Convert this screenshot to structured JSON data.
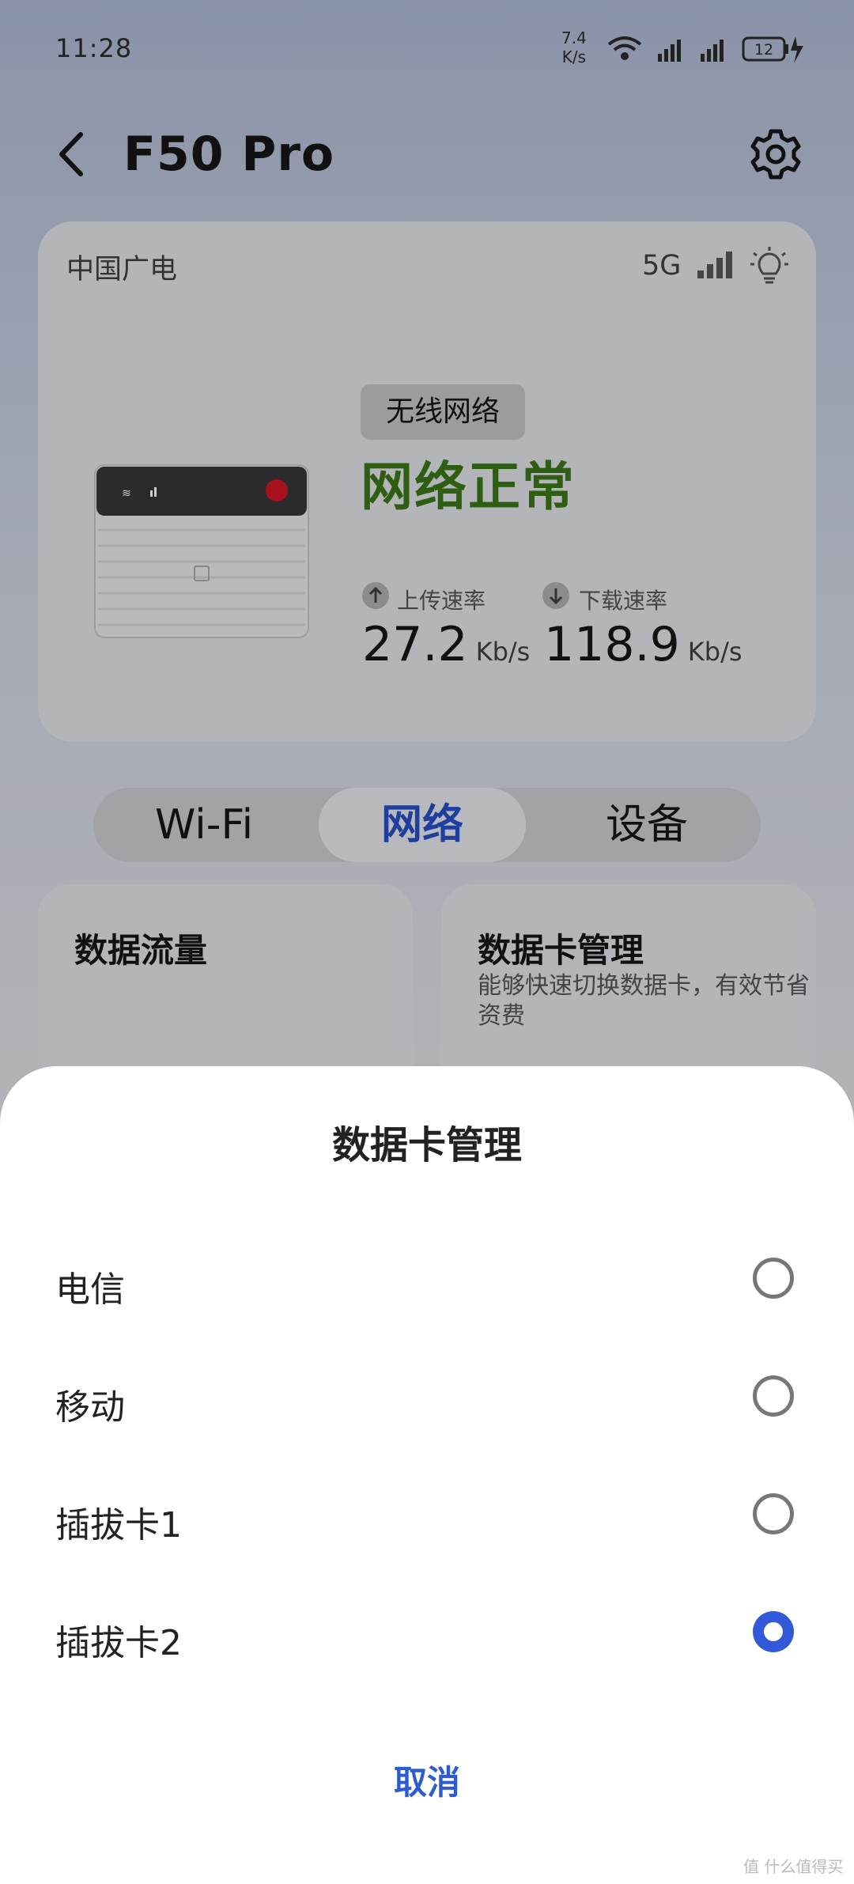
{
  "status_bar": {
    "time": "11:28",
    "net_speed_value": "7.4",
    "net_speed_unit": "K/s",
    "battery": "12"
  },
  "header": {
    "title": "F50 Pro"
  },
  "device_card": {
    "carrier": "中国广电",
    "network_type": "5G",
    "connection_badge": "无线网络",
    "network_status": "网络正常",
    "upload_label": "上传速率",
    "upload_value": "27.2",
    "upload_unit": "Kb/s",
    "download_label": "下载速率",
    "download_value": "118.9",
    "download_unit": "Kb/s"
  },
  "tabs": [
    {
      "label": "Wi-Fi"
    },
    {
      "label": "网络"
    },
    {
      "label": "设备"
    }
  ],
  "feature_cards": {
    "left_title": "数据流量",
    "right_title": "数据卡管理",
    "right_desc": "能够快速切换数据卡，有效节省资费"
  },
  "sheet": {
    "title": "数据卡管理",
    "options": [
      {
        "label": "电信"
      },
      {
        "label": "移动"
      },
      {
        "label": "插拔卡1"
      },
      {
        "label": "插拔卡2"
      }
    ],
    "selected": "插拔卡2",
    "cancel_label": "取消"
  },
  "watermark": "值 什么值得买",
  "colors": {
    "accent": "#3259d8",
    "status_green": "#2d5e12"
  }
}
